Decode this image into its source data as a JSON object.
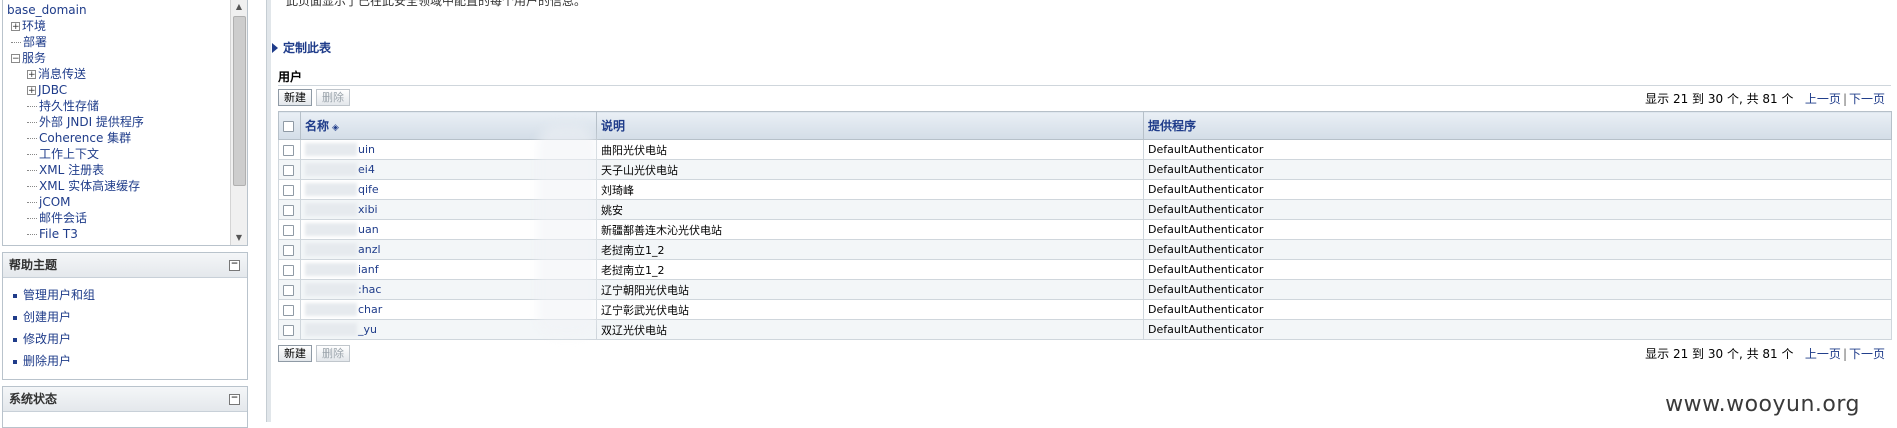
{
  "tree": {
    "items": [
      {
        "label": "base_domain",
        "level": 0,
        "expander": ""
      },
      {
        "label": "环境",
        "level": 1,
        "expander": "+"
      },
      {
        "label": "部署",
        "level": 1,
        "expander": ""
      },
      {
        "label": "服务",
        "level": 1,
        "expander": "-"
      },
      {
        "label": "消息传送",
        "level": 2,
        "expander": "+"
      },
      {
        "label": "JDBC",
        "level": 2,
        "expander": "+"
      },
      {
        "label": "持久性存储",
        "level": 2,
        "expander": ""
      },
      {
        "label": "外部 JNDI 提供程序",
        "level": 2,
        "expander": ""
      },
      {
        "label": "Coherence 集群",
        "level": 2,
        "expander": ""
      },
      {
        "label": "工作上下文",
        "level": 2,
        "expander": ""
      },
      {
        "label": "XML 注册表",
        "level": 2,
        "expander": ""
      },
      {
        "label": "XML 实体高速缓存",
        "level": 2,
        "expander": ""
      },
      {
        "label": "jCOM",
        "level": 2,
        "expander": ""
      },
      {
        "label": "邮件会话",
        "level": 2,
        "expander": ""
      },
      {
        "label": "File T3",
        "level": 2,
        "expander": ""
      }
    ]
  },
  "help_panel": {
    "title": "帮助主题",
    "collapse_glyph": "⊟",
    "links": [
      "管理用户和组",
      "创建用户",
      "修改用户",
      "删除用户"
    ]
  },
  "status_panel": {
    "title": "系统状态",
    "collapse_glyph": "⊟"
  },
  "content": {
    "partial_text": "此页面显示了已在此安全领域中配置的每个用户的信息。",
    "customize_label": "定制此表",
    "section_title": "用户",
    "new_button": "新建",
    "delete_button": "删除",
    "pager": {
      "showing": "显示 21 到 30 个, 共 81 个",
      "prev": "上一页",
      "divider": "|",
      "next": "下一页"
    },
    "columns": {
      "name": "名称",
      "description": "说明",
      "provider": "提供程序"
    },
    "rows": [
      {
        "name": "uin",
        "description": "曲阳光伏电站",
        "provider": "DefaultAuthenticator"
      },
      {
        "name": "ei4",
        "description": "天子山光伏电站",
        "provider": "DefaultAuthenticator"
      },
      {
        "name": "qife",
        "description": "刘琦峰",
        "provider": "DefaultAuthenticator"
      },
      {
        "name": "xibi",
        "description": "姚安",
        "provider": "DefaultAuthenticator"
      },
      {
        "name": "uan",
        "description": "新疆鄯善连木沁光伏电站",
        "provider": "DefaultAuthenticator"
      },
      {
        "name": "anzl",
        "description": "老挝南立1_2",
        "provider": "DefaultAuthenticator"
      },
      {
        "name": "ianf",
        "description": "老挝南立1_2",
        "provider": "DefaultAuthenticator"
      },
      {
        "name": ":hac",
        "description": "辽宁朝阳光伏电站",
        "provider": "DefaultAuthenticator"
      },
      {
        "name": "char",
        "description": "辽宁彰武光伏电站",
        "provider": "DefaultAuthenticator"
      },
      {
        "name": "_yu",
        "description": "双辽光伏电站",
        "provider": "DefaultAuthenticator"
      }
    ]
  },
  "watermark": "www.wooyun.org"
}
